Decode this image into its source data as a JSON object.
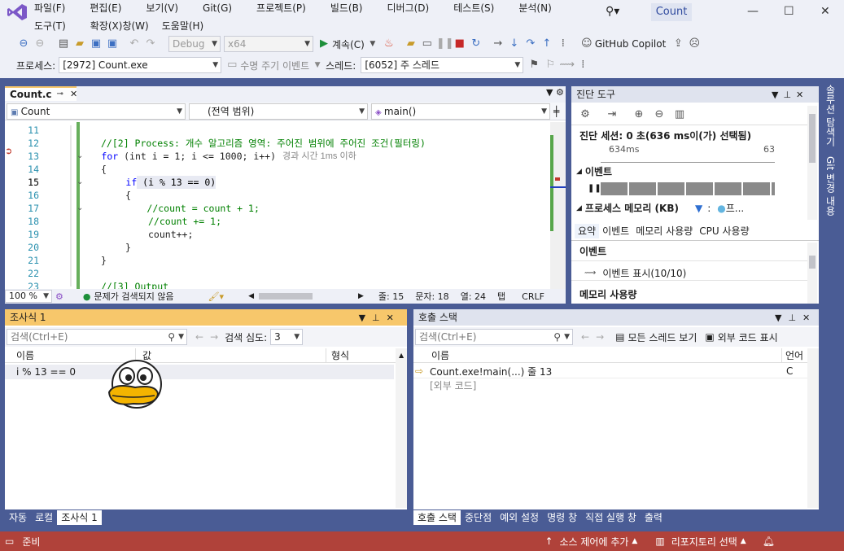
{
  "menu": {
    "items": [
      "파일(F)",
      "편집(E)",
      "보기(V)",
      "Git(G)",
      "프로젝트(P)",
      "빌드(B)",
      "디버그(D)",
      "테스트(S)",
      "분석(N)",
      "도구(T)",
      "확장(X)",
      "창(W)",
      "도움말(H)"
    ]
  },
  "app": {
    "title": "Count"
  },
  "toolbar1": {
    "config": "Debug",
    "platform": "x64",
    "continue_label": "계속(C)",
    "copilot_label": "GitHub Copilot"
  },
  "toolbar2": {
    "process_label": "프로세스:",
    "process_value": "[2972] Count.exe",
    "lifecycle_label": "수명 주기 이벤트",
    "thread_label": "스레드:",
    "thread_value": "[6052] 주 스레드"
  },
  "editor": {
    "tab_label": "Count.c",
    "tab_pin": "⊸",
    "nav_project": "Count",
    "nav_scope": "(전역 범위)",
    "nav_function": "main()",
    "lines": [
      {
        "n": "11",
        "text": ""
      },
      {
        "n": "12",
        "text": "//[2] Process: 개수 알고리즘 영역: 주어진 범위에 주어진 조건(필터링)"
      },
      {
        "n": "13",
        "kw": "for",
        "text": " (int i = 1; i <= 1000; i++)",
        "hint": "경과 시간 1ms 이하"
      },
      {
        "n": "14",
        "text": "{"
      },
      {
        "n": "15",
        "kw": "if",
        "text": " (i % 13 == 0)"
      },
      {
        "n": "16",
        "text": "{"
      },
      {
        "n": "17",
        "text": "//count = count + 1;"
      },
      {
        "n": "18",
        "text": "//count += 1;"
      },
      {
        "n": "19",
        "text": "count++;"
      },
      {
        "n": "20",
        "text": "}"
      },
      {
        "n": "21",
        "text": "}"
      },
      {
        "n": "22",
        "text": ""
      },
      {
        "n": "23",
        "text": "//[3] Output"
      }
    ],
    "zoom": "100 %",
    "issues": "문제가 검색되지 않음",
    "row_label": "줄: 15",
    "char_label": "문자: 18",
    "col_label": "열: 24",
    "tab_mode": "탭",
    "eol": "CRLF"
  },
  "diagnostics": {
    "title": "진단 도구",
    "session": "진단 세션: 0 초(636 ms이(가) 선택됨)",
    "tick1": "634ms",
    "tick2": "63",
    "events_label": "이벤트",
    "memory_label": "프로세스 메모리 (KB)",
    "memory_legend": "프...",
    "tabs": [
      "요약",
      "이벤트",
      "메모리 사용량",
      "CPU 사용량"
    ],
    "section_events": "이벤트",
    "events_show": "이벤트 표시(10/10)",
    "section_memory": "메모리 사용량"
  },
  "sidebar": {
    "explorer": "솔루션 탐색기",
    "git": "Git 변경 내용"
  },
  "watch": {
    "title": "조사식 1",
    "search_placeholder": "검색(Ctrl+E)",
    "depth_label": "검색 심도:",
    "depth_value": "3",
    "col_name": "이름",
    "col_value": "값",
    "col_type": "형식",
    "rows": [
      {
        "name": "i % 13 == 0",
        "value": "",
        "type": ""
      }
    ]
  },
  "callstack": {
    "title": "호출 스택",
    "search_placeholder": "검색(Ctrl+E)",
    "all_threads": "모든 스레드 보기",
    "external_code": "외부 코드 표시",
    "col_name": "이름",
    "col_lang": "언어",
    "rows": [
      {
        "name": "Count.exe!main(...) 줄 13",
        "lang": "C"
      },
      {
        "name": "[외부 코드]",
        "lang": ""
      }
    ]
  },
  "bottom_tabs_left": [
    "자동",
    "로컬",
    "조사식 1"
  ],
  "bottom_tabs_right": [
    "호출 스택",
    "중단점",
    "예외 설정",
    "명령 창",
    "직접 실행 창",
    "출력"
  ],
  "status": {
    "ready": "준비",
    "source_control": "소스 제어에 추가",
    "repo": "리포지토리 선택"
  },
  "colors": {
    "accent": "#4a5c95",
    "status_bar": "#b0423a",
    "tab_highlight": "#f7c76b",
    "keyword": "#0000ff",
    "comment": "#008000",
    "line_number": "#2b91af"
  }
}
